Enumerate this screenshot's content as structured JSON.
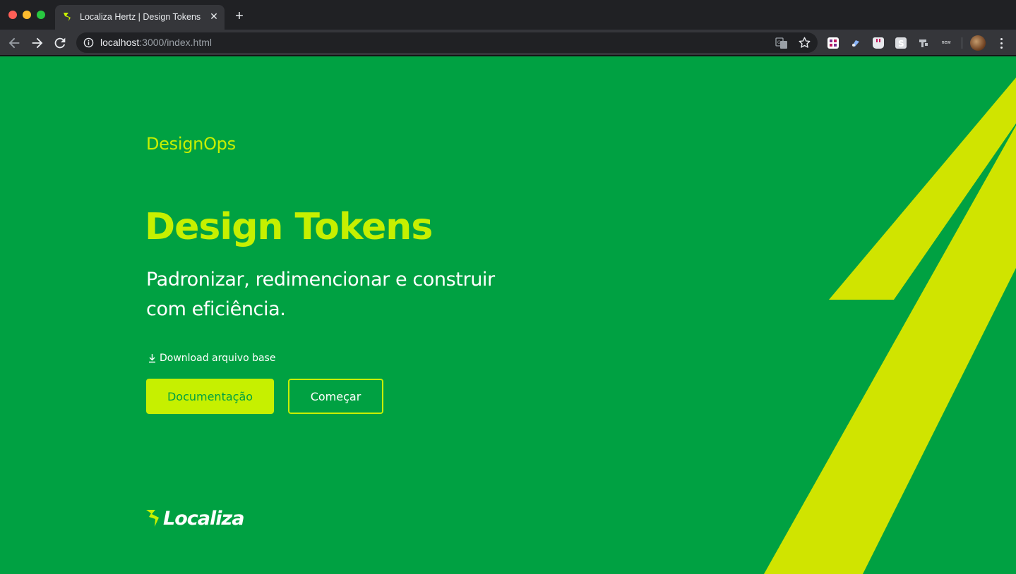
{
  "browser": {
    "tab": {
      "title": "Localiza Hertz | Design Tokens",
      "close_glyph": "✕",
      "favicon": "localiza-mark-icon"
    },
    "new_tab_glyph": "+",
    "address": {
      "host": "localhost",
      "path": ":3000/index.html"
    },
    "icons": [
      "back-icon",
      "forward-icon",
      "reload-icon",
      "info-icon",
      "translate-icon",
      "star-icon",
      "menu-icon"
    ],
    "extension_text": "new"
  },
  "page": {
    "eyebrow": "DesignOps",
    "title": "Design Tokens",
    "subtitle": "Padronizar, redimencionar e construir com eficiência.",
    "download_label": "Download arquivo base",
    "primary_button": "Documentação",
    "secondary_button": "Começar",
    "logo_text": "Localiza"
  },
  "colors": {
    "background": "#00a142",
    "accent": "#c6f000",
    "stripe": "#d0e400",
    "text": "#ffffff"
  }
}
